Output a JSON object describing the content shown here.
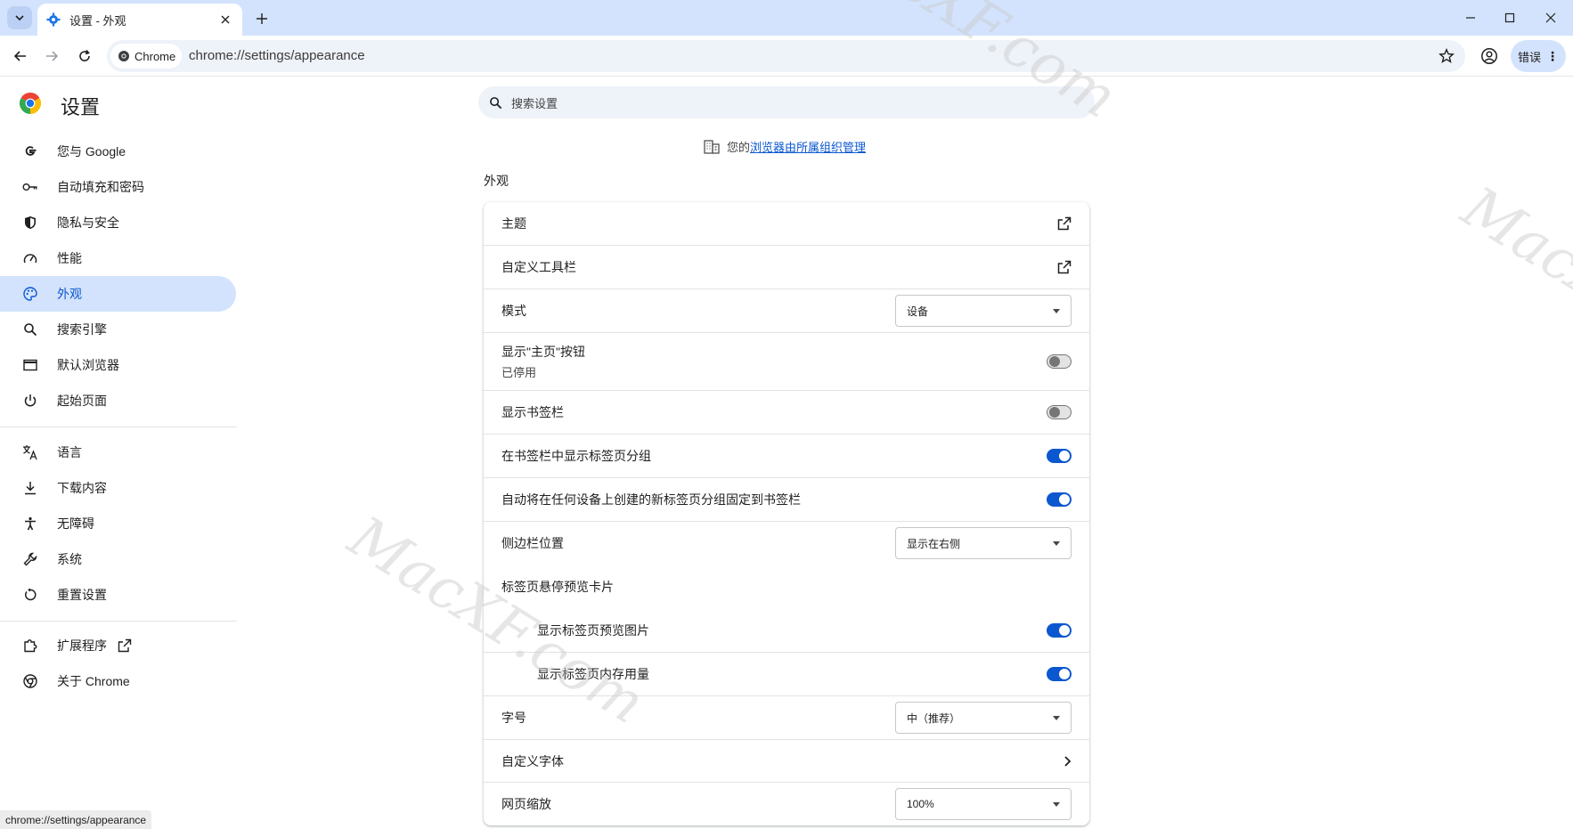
{
  "tab": {
    "title": "设置 - 外观",
    "close_label": "×",
    "new_label": "+"
  },
  "toolbar": {
    "chip_label": "Chrome",
    "url": "chrome://settings/appearance",
    "error_label": "错误",
    "error_dots": "⋮"
  },
  "app": {
    "title": "设置"
  },
  "sidebar": {
    "items": [
      {
        "label": "您与 Google",
        "icon": "google-g-icon"
      },
      {
        "label": "自动填充和密码",
        "icon": "key-icon"
      },
      {
        "label": "隐私与安全",
        "icon": "shield-icon"
      },
      {
        "label": "性能",
        "icon": "speedometer-icon"
      },
      {
        "label": "外观",
        "icon": "palette-icon"
      },
      {
        "label": "搜索引擎",
        "icon": "search-icon"
      },
      {
        "label": "默认浏览器",
        "icon": "browser-window-icon"
      },
      {
        "label": "起始页面",
        "icon": "power-icon"
      },
      {
        "label": "语言",
        "icon": "translate-icon"
      },
      {
        "label": "下载内容",
        "icon": "download-icon"
      },
      {
        "label": "无障碍",
        "icon": "accessibility-icon"
      },
      {
        "label": "系统",
        "icon": "wrench-icon"
      },
      {
        "label": "重置设置",
        "icon": "reset-icon"
      },
      {
        "label": "扩展程序",
        "icon": "extension-icon"
      },
      {
        "label": "关于 Chrome",
        "icon": "chrome-icon"
      }
    ],
    "active": "外观"
  },
  "search": {
    "placeholder": "搜索设置"
  },
  "managed": {
    "prefix": "您的",
    "link": "浏览器由所属组织管理"
  },
  "section": {
    "title": "外观"
  },
  "settings": {
    "theme": "主题",
    "toolbar": "自定义工具栏",
    "mode": {
      "label": "模式",
      "value": "设备"
    },
    "home_button": {
      "label": "显示\"主页\"按钮",
      "sublabel": "已停用",
      "enabled": false
    },
    "bookmarks_bar": {
      "label": "显示书签栏",
      "enabled": false
    },
    "tab_groups_in_bar": {
      "label": "在书签栏中显示标签页分组",
      "enabled": true
    },
    "pin_new_groups": {
      "label": "自动将在任何设备上创建的新标签页分组固定到书签栏",
      "enabled": true
    },
    "side_panel": {
      "label": "侧边栏位置",
      "value": "显示在右侧"
    },
    "hover_card": {
      "label": "标签页悬停预览卡片",
      "preview_image": {
        "label": "显示标签页预览图片",
        "enabled": true
      },
      "memory_usage": {
        "label": "显示标签页内存用量",
        "enabled": true
      }
    },
    "font_size": {
      "label": "字号",
      "value": "中（推荐）"
    },
    "custom_fonts": "自定义字体",
    "zoom": {
      "label": "网页缩放",
      "value": "100%"
    }
  },
  "statusbar": {
    "text": "chrome://settings/appearance"
  },
  "watermark": {
    "text": "MacXF.com"
  },
  "colors": {
    "accent": "#0b57d0",
    "active_bg": "#d3e3fd",
    "tabstrip": "#d3e3fd"
  }
}
